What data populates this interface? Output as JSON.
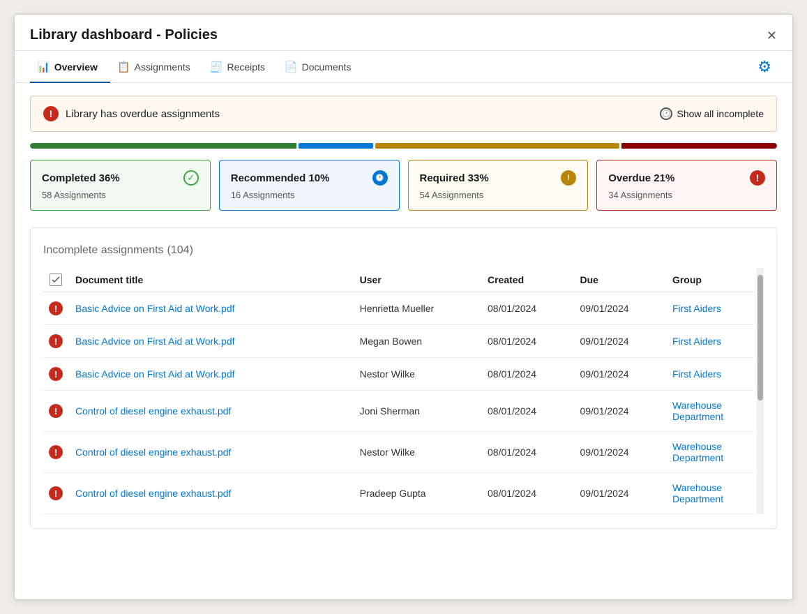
{
  "window": {
    "title": "Library dashboard - Policies"
  },
  "tabs": [
    {
      "id": "overview",
      "label": "Overview",
      "icon": "📊",
      "active": true
    },
    {
      "id": "assignments",
      "label": "Assignments",
      "icon": "📋",
      "active": false
    },
    {
      "id": "receipts",
      "label": "Receipts",
      "icon": "🧾",
      "active": false
    },
    {
      "id": "documents",
      "label": "Documents",
      "icon": "📄",
      "active": false
    }
  ],
  "alert": {
    "message": "Library has overdue assignments",
    "show_all_label": "Show all incomplete"
  },
  "progress": [
    {
      "label": "completed",
      "color": "#2e7d32",
      "pct": 36
    },
    {
      "label": "recommended",
      "color": "#0078d4",
      "pct": 10
    },
    {
      "label": "required",
      "color": "#b8860b",
      "pct": 33
    },
    {
      "label": "overdue",
      "color": "#8b0000",
      "pct": 21
    }
  ],
  "stat_cards": [
    {
      "id": "completed",
      "title": "Completed 36%",
      "subtitle": "58 Assignments",
      "icon": "✓",
      "type": "completed"
    },
    {
      "id": "recommended",
      "title": "Recommended 10%",
      "subtitle": "16 Assignments",
      "icon": "🕐",
      "type": "recommended"
    },
    {
      "id": "required",
      "title": "Required 33%",
      "subtitle": "54 Assignments",
      "icon": "!",
      "type": "required"
    },
    {
      "id": "overdue",
      "title": "Overdue 21%",
      "subtitle": "34 Assignments",
      "icon": "!",
      "type": "overdue"
    }
  ],
  "incomplete_section": {
    "title": "Incomplete assignments",
    "count": "(104)"
  },
  "table": {
    "columns": [
      "",
      "Document title",
      "User",
      "Created",
      "Due",
      "Group"
    ],
    "rows": [
      {
        "status": "overdue",
        "doc": "Basic Advice on First Aid at Work.pdf",
        "user": "Henrietta Mueller",
        "created": "08/01/2024",
        "due": "09/01/2024",
        "group": "First Aiders"
      },
      {
        "status": "overdue",
        "doc": "Basic Advice on First Aid at Work.pdf",
        "user": "Megan Bowen",
        "created": "08/01/2024",
        "due": "09/01/2024",
        "group": "First Aiders"
      },
      {
        "status": "overdue",
        "doc": "Basic Advice on First Aid at Work.pdf",
        "user": "Nestor Wilke",
        "created": "08/01/2024",
        "due": "09/01/2024",
        "group": "First Aiders"
      },
      {
        "status": "overdue",
        "doc": "Control of diesel engine exhaust.pdf",
        "user": "Joni Sherman",
        "created": "08/01/2024",
        "due": "09/01/2024",
        "group": "Warehouse Department"
      },
      {
        "status": "overdue",
        "doc": "Control of diesel engine exhaust.pdf",
        "user": "Nestor Wilke",
        "created": "08/01/2024",
        "due": "09/01/2024",
        "group": "Warehouse Department"
      },
      {
        "status": "overdue",
        "doc": "Control of diesel engine exhaust.pdf",
        "user": "Pradeep Gupta",
        "created": "08/01/2024",
        "due": "09/01/2024",
        "group": "Warehouse Department"
      }
    ]
  }
}
